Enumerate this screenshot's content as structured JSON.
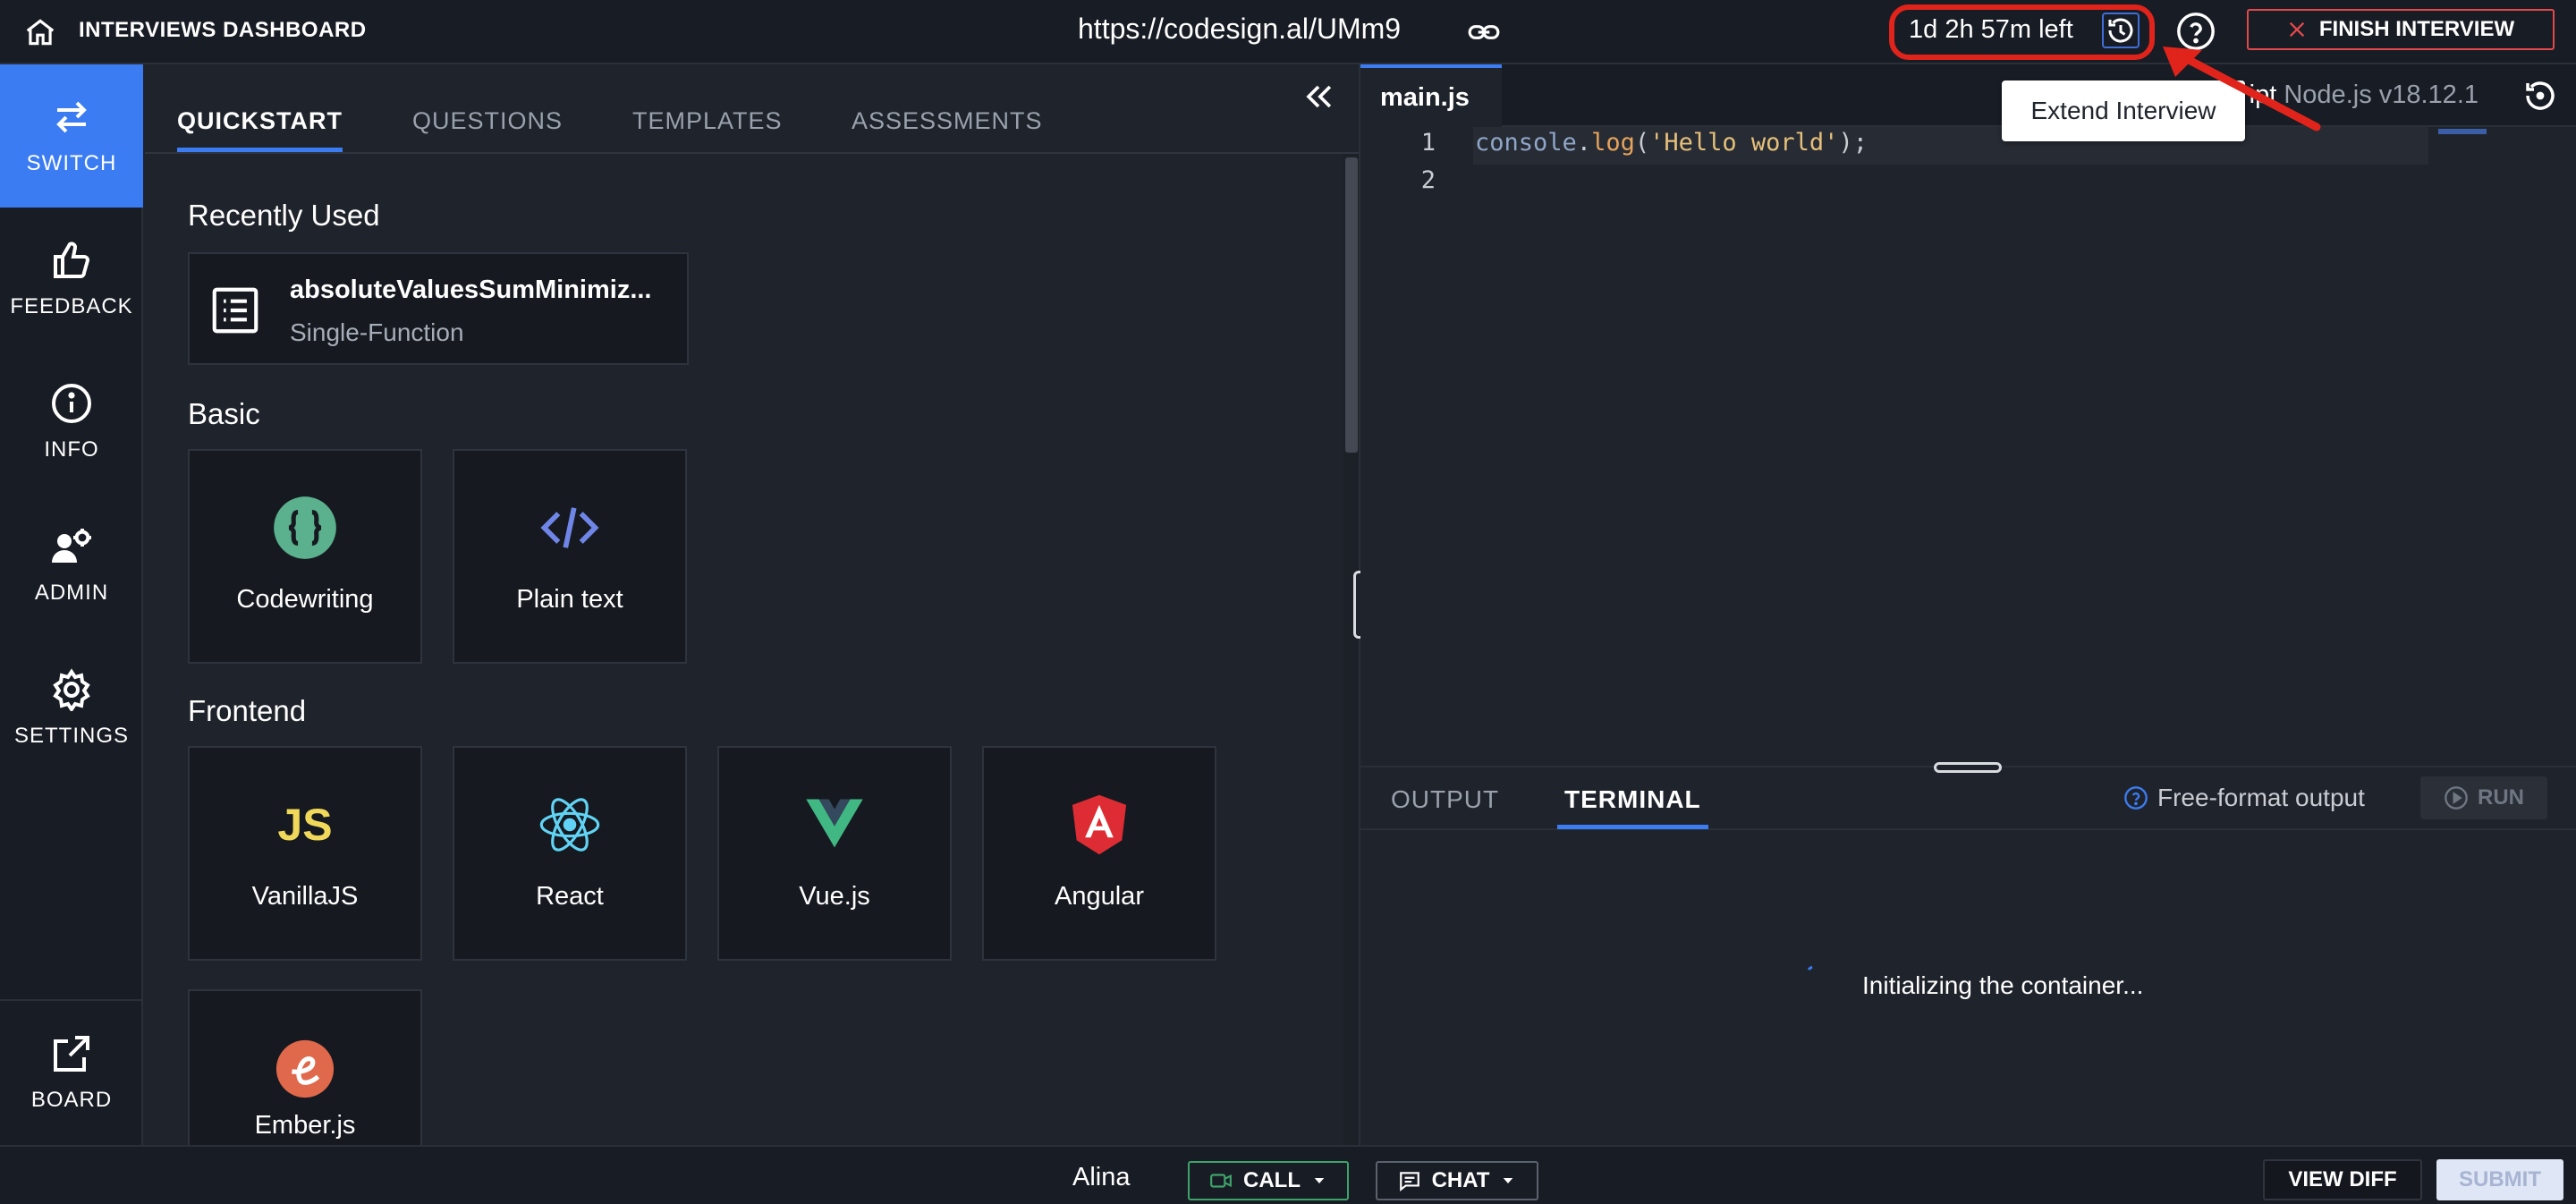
{
  "header": {
    "title": "INTERVIEWS DASHBOARD",
    "url": "https://codesign.al/UMm9",
    "time_left": "1d 2h 57m left",
    "finish_label": "FINISH INTERVIEW",
    "tooltip": "Extend Interview",
    "accent_annotation_color": "#e0241b"
  },
  "rail": {
    "items": [
      {
        "label": "SWITCH",
        "icon": "switch-arrows-icon",
        "active": true
      },
      {
        "label": "FEEDBACK",
        "icon": "thumbs-up-icon"
      },
      {
        "label": "INFO",
        "icon": "info-icon"
      },
      {
        "label": "ADMIN",
        "icon": "admin-gear-user-icon"
      },
      {
        "label": "SETTINGS",
        "icon": "gear-icon"
      },
      {
        "label": "BOARD",
        "icon": "external-link-icon"
      }
    ]
  },
  "panel": {
    "tabs": [
      "QUICKSTART",
      "QUESTIONS",
      "TEMPLATES",
      "ASSESSMENTS"
    ],
    "recent": {
      "heading": "Recently Used",
      "title": "absoluteValuesSumMinimiz...",
      "subtitle": "Single-Function"
    },
    "basic": {
      "heading": "Basic",
      "tiles": [
        {
          "label": "Codewriting",
          "icon": "codewriting-icon"
        },
        {
          "label": "Plain text",
          "icon": "code-tag-icon"
        }
      ]
    },
    "frontend": {
      "heading": "Frontend",
      "tiles": [
        {
          "label": "VanillaJS",
          "icon": "js-icon"
        },
        {
          "label": "React",
          "icon": "react-icon"
        },
        {
          "label": "Vue.js",
          "icon": "vue-icon"
        },
        {
          "label": "Angular",
          "icon": "angular-icon"
        },
        {
          "label": "Ember.js",
          "icon": "ember-icon"
        }
      ]
    }
  },
  "editor": {
    "file_tab": "main.js",
    "language_partial": "ript",
    "runtime": "Node.js v18.12.1",
    "lines": [
      {
        "number": "1",
        "tokens": [
          "console",
          ".",
          "log",
          "(",
          "'Hello world'",
          ");"
        ]
      },
      {
        "number": "2",
        "tokens": []
      }
    ]
  },
  "output": {
    "tabs": [
      "OUTPUT",
      "TERMINAL"
    ],
    "active_tab": "TERMINAL",
    "free_format": "Free-format output",
    "run_label": "RUN",
    "status": "Initializing the container..."
  },
  "footer": {
    "user": "Alina",
    "call_label": "CALL",
    "chat_label": "CHAT",
    "view_diff_label": "VIEW DIFF",
    "submit_label": "SUBMIT"
  }
}
